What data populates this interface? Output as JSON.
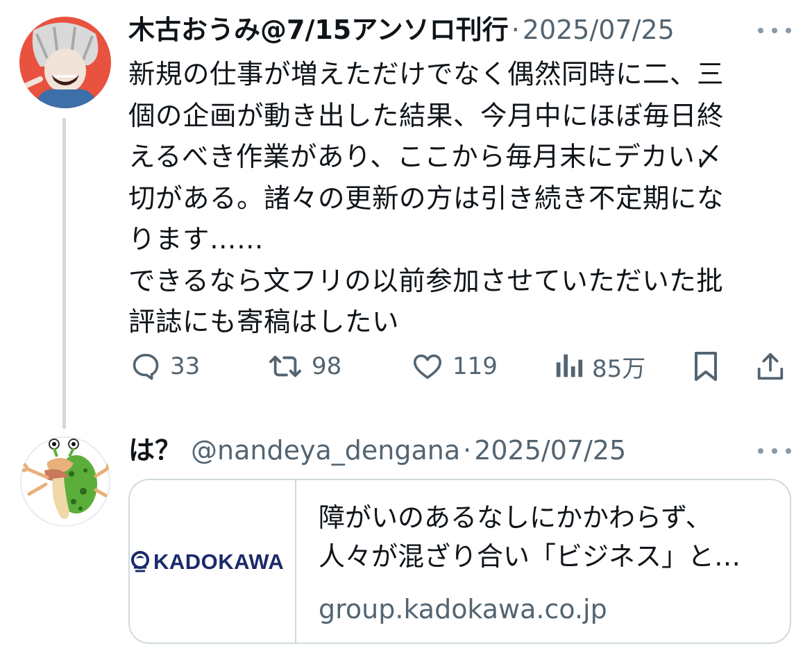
{
  "tweet1": {
    "author_name": "木古おうみ@7/15アンソロ刊行",
    "separator": "·",
    "date": "2025/07/25",
    "text": "新規の仕事が増えただけでなく偶然同時に二、三\n個の企画が動き出した結果、今月中にほぼ毎日終\nえるべき作業があり、ここから毎月末にデカい〆\n切がある。諸々の更新の方は引き続き不定期にな\nります……\nできるなら文フリの以前参加させていただいた批\n評誌にも寄稿はしたい",
    "actions": {
      "replies": "33",
      "retweets": "98",
      "likes": "119",
      "views": "85万"
    }
  },
  "tweet2": {
    "author_name": "は？",
    "handle": "@nandeya_dengana",
    "separator": "·",
    "date": "2025/07/25",
    "card": {
      "logo_text": "KADOKAWA",
      "description": "障がいのあるなしにかかわらず、\n人々が混ざり合い「ビジネス」と…",
      "domain": "group.kadokawa.co.jp"
    }
  },
  "colors": {
    "text_primary": "#0f1419",
    "text_secondary": "#536471",
    "border": "#cfd9de"
  },
  "icons": [
    "reply-icon",
    "retweet-icon",
    "like-icon",
    "views-icon",
    "bookmark-icon",
    "share-icon",
    "more-icon"
  ]
}
